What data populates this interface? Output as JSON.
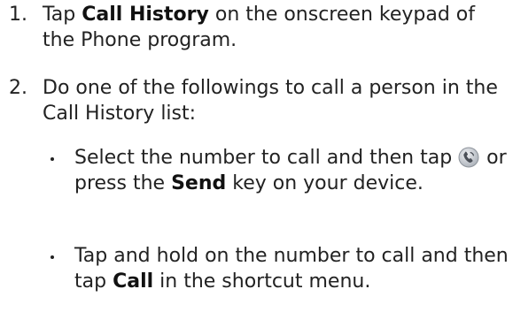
{
  "steps": [
    {
      "number": "1.",
      "parts": [
        "Tap ",
        "Call History",
        " on the onscreen keypad of the Phone program."
      ]
    },
    {
      "number": "2.",
      "text": "Do one of the followings to call a person in the Call History list:",
      "bullets": [
        {
          "parts": [
            "Select the number to call and then tap ",
            " or press the ",
            "Send",
            " key on your device."
          ],
          "icon": "phone-call-icon"
        },
        {
          "parts": [
            "Tap and hold on the number to call and then tap ",
            "Call",
            " in the shortcut menu."
          ]
        }
      ]
    }
  ],
  "colors": {
    "text": "#222222",
    "icon_ring": "#c8ccd2",
    "icon_fill": "#4a4f57"
  }
}
